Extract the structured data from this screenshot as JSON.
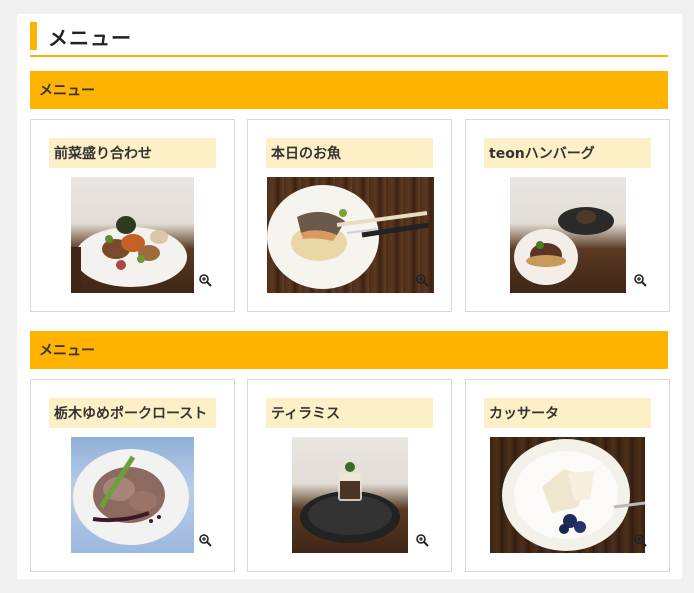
{
  "page": {
    "title": "メニュー"
  },
  "sections": [
    {
      "heading": "メニュー",
      "items": [
        {
          "name": "前菜盛り合わせ",
          "zoom_icon": "zoom-in-icon"
        },
        {
          "name": "本日のお魚",
          "zoom_icon": "zoom-in-icon"
        },
        {
          "name": "teonハンバーグ",
          "zoom_icon": "zoom-in-icon"
        }
      ]
    },
    {
      "heading": "メニュー",
      "items": [
        {
          "name": "栃木ゆめポークロースト",
          "zoom_icon": "zoom-in-icon"
        },
        {
          "name": "ティラミス",
          "zoom_icon": "zoom-in-icon"
        },
        {
          "name": "カッサータ",
          "zoom_icon": "zoom-in-icon"
        }
      ]
    }
  ],
  "colors": {
    "accent": "#fdb300",
    "label_bg": "#fdf0c6"
  }
}
